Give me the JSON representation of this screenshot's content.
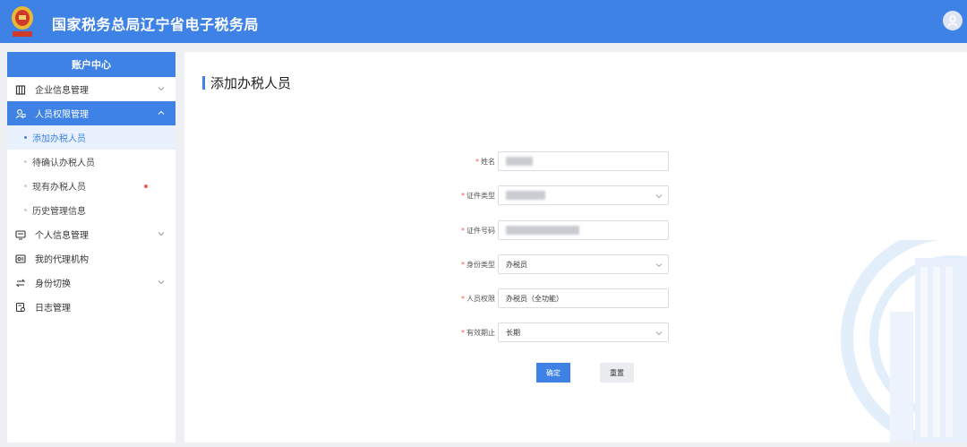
{
  "header": {
    "site_title": "国家税务总局辽宁省电子税务局"
  },
  "sidebar": {
    "title": "账户中心",
    "menu": [
      {
        "label": "企业信息管理",
        "icon": "building-icon",
        "expandable": true
      },
      {
        "label": "人员权限管理",
        "icon": "user-lock-icon",
        "expandable": true,
        "active": true
      },
      {
        "label": "个人信息管理",
        "icon": "id-card-icon",
        "expandable": true
      },
      {
        "label": "我的代理机构",
        "icon": "agency-icon",
        "expandable": false
      },
      {
        "label": "身份切换",
        "icon": "switch-icon",
        "expandable": true
      },
      {
        "label": "日志管理",
        "icon": "log-icon",
        "expandable": false
      }
    ],
    "sub_items": [
      {
        "label": "添加办税人员",
        "selected": true
      },
      {
        "label": "待确认办税人员"
      },
      {
        "label": "现有办税人员",
        "badge": true
      },
      {
        "label": "历史管理信息"
      }
    ]
  },
  "main": {
    "page_title": "添加办税人员",
    "required_mark": "*",
    "form": {
      "name_label": "姓名",
      "id_type_label": "证件类型",
      "id_number_label": "证件号码",
      "identity_type_label": "身份类型",
      "identity_type_value": "办税员",
      "permission_label": "人员权限",
      "permission_value": "办税员（全功能）",
      "validity_label": "有效期止",
      "validity_value": "长期"
    },
    "buttons": {
      "confirm": "确定",
      "reset": "重置"
    }
  },
  "colors": {
    "brand": "#3f82e6",
    "required": "#f05c4c"
  }
}
